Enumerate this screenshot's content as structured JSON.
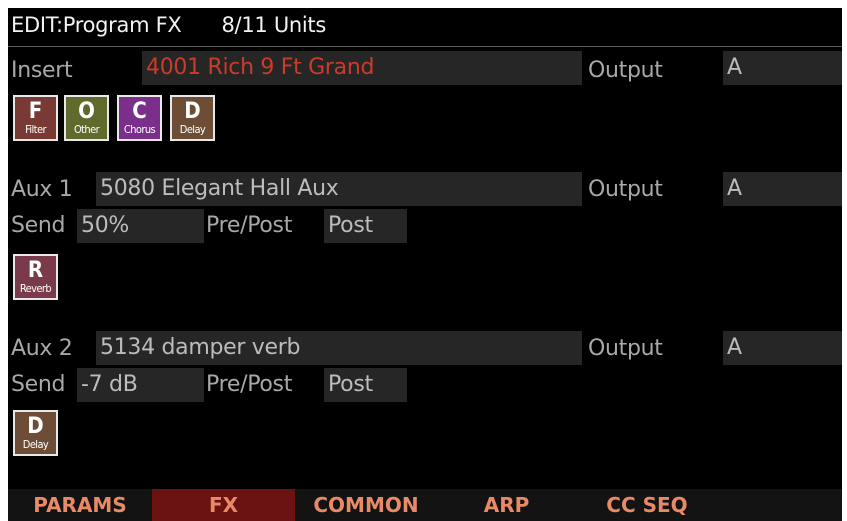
{
  "header": {
    "mode": "EDIT:Program FX",
    "units": "8/11 Units"
  },
  "insert": {
    "label": "Insert",
    "value": "4001 Rich 9 Ft Grand",
    "output_label": "Output",
    "output_value": "A",
    "fx_blocks": [
      {
        "letter": "F",
        "name": "Filter",
        "color": "#7a3a34"
      },
      {
        "letter": "O",
        "name": "Other",
        "color": "#5f6a2c"
      },
      {
        "letter": "C",
        "name": "Chorus",
        "color": "#7a2f8a"
      },
      {
        "letter": "D",
        "name": "Delay",
        "color": "#6e4d36"
      }
    ]
  },
  "aux1": {
    "label": "Aux 1",
    "value": "5080 Elegant Hall Aux",
    "output_label": "Output",
    "output_value": "A",
    "send_label": "Send",
    "send_value": "50%",
    "prepost_label": "Pre/Post",
    "prepost_value": "Post",
    "fx_blocks": [
      {
        "letter": "R",
        "name": "Reverb",
        "color": "#7a3a4a"
      }
    ]
  },
  "aux2": {
    "label": "Aux 2",
    "value": "5134 damper  verb",
    "output_label": "Output",
    "output_value": "A",
    "send_label": "Send",
    "send_value": "-7 dB",
    "prepost_label": "Pre/Post",
    "prepost_value": "Post",
    "fx_blocks": [
      {
        "letter": "D",
        "name": "Delay",
        "color": "#6e4d36"
      }
    ]
  },
  "tabs": [
    {
      "label": "PARAMS",
      "active": false
    },
    {
      "label": "FX",
      "active": true
    },
    {
      "label": "COMMON",
      "active": false
    },
    {
      "label": "ARP",
      "active": false
    },
    {
      "label": "CC SEQ",
      "active": false
    },
    {
      "label": "",
      "active": false
    }
  ],
  "colors": {
    "background": "#000000",
    "field": "#262626",
    "insert_value": "#cc3a2a",
    "tab_text": "#e88a66",
    "tab_active": "#6b1212"
  }
}
